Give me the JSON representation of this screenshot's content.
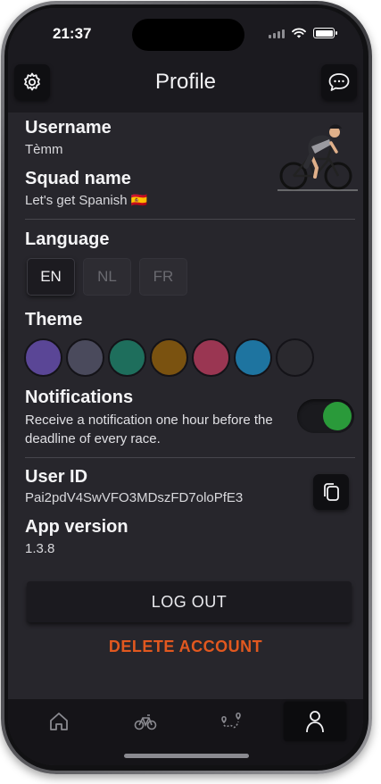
{
  "status_bar": {
    "time": "21:37"
  },
  "header": {
    "title": "Profile",
    "settings_icon": "gear-icon",
    "chat_icon": "chat-bubble-icon"
  },
  "profile": {
    "username_label": "Username",
    "username_value": "Tèmm",
    "squad_label": "Squad name",
    "squad_value": "Let's get Spanish 🇪🇸"
  },
  "language": {
    "label": "Language",
    "options": [
      "EN",
      "NL",
      "FR"
    ],
    "selected": "EN"
  },
  "theme": {
    "label": "Theme",
    "colors": [
      "#5a4696",
      "#4a4a5c",
      "#1e6e5c",
      "#7a5210",
      "#9a3652",
      "#1e74a0",
      "#2a292e"
    ]
  },
  "notifications": {
    "label": "Notifications",
    "description": "Receive a notification one hour before the deadline of every race.",
    "enabled": true,
    "toggle_color": "#2a9a3a"
  },
  "user": {
    "id_label": "User ID",
    "id_value": "Pai2pdV4SwVFO3MDszFD7oloPfE3",
    "copy_icon": "copy-icon",
    "version_label": "App version",
    "version_value": "1.3.8"
  },
  "actions": {
    "logout_label": "LOG OUT",
    "delete_label": "DELETE ACCOUNT",
    "delete_color": "#e2581f"
  },
  "tabbar": {
    "tabs": [
      "home-icon",
      "bicycle-icon",
      "route-map-icon",
      "profile-icon"
    ],
    "active": "profile-icon"
  }
}
